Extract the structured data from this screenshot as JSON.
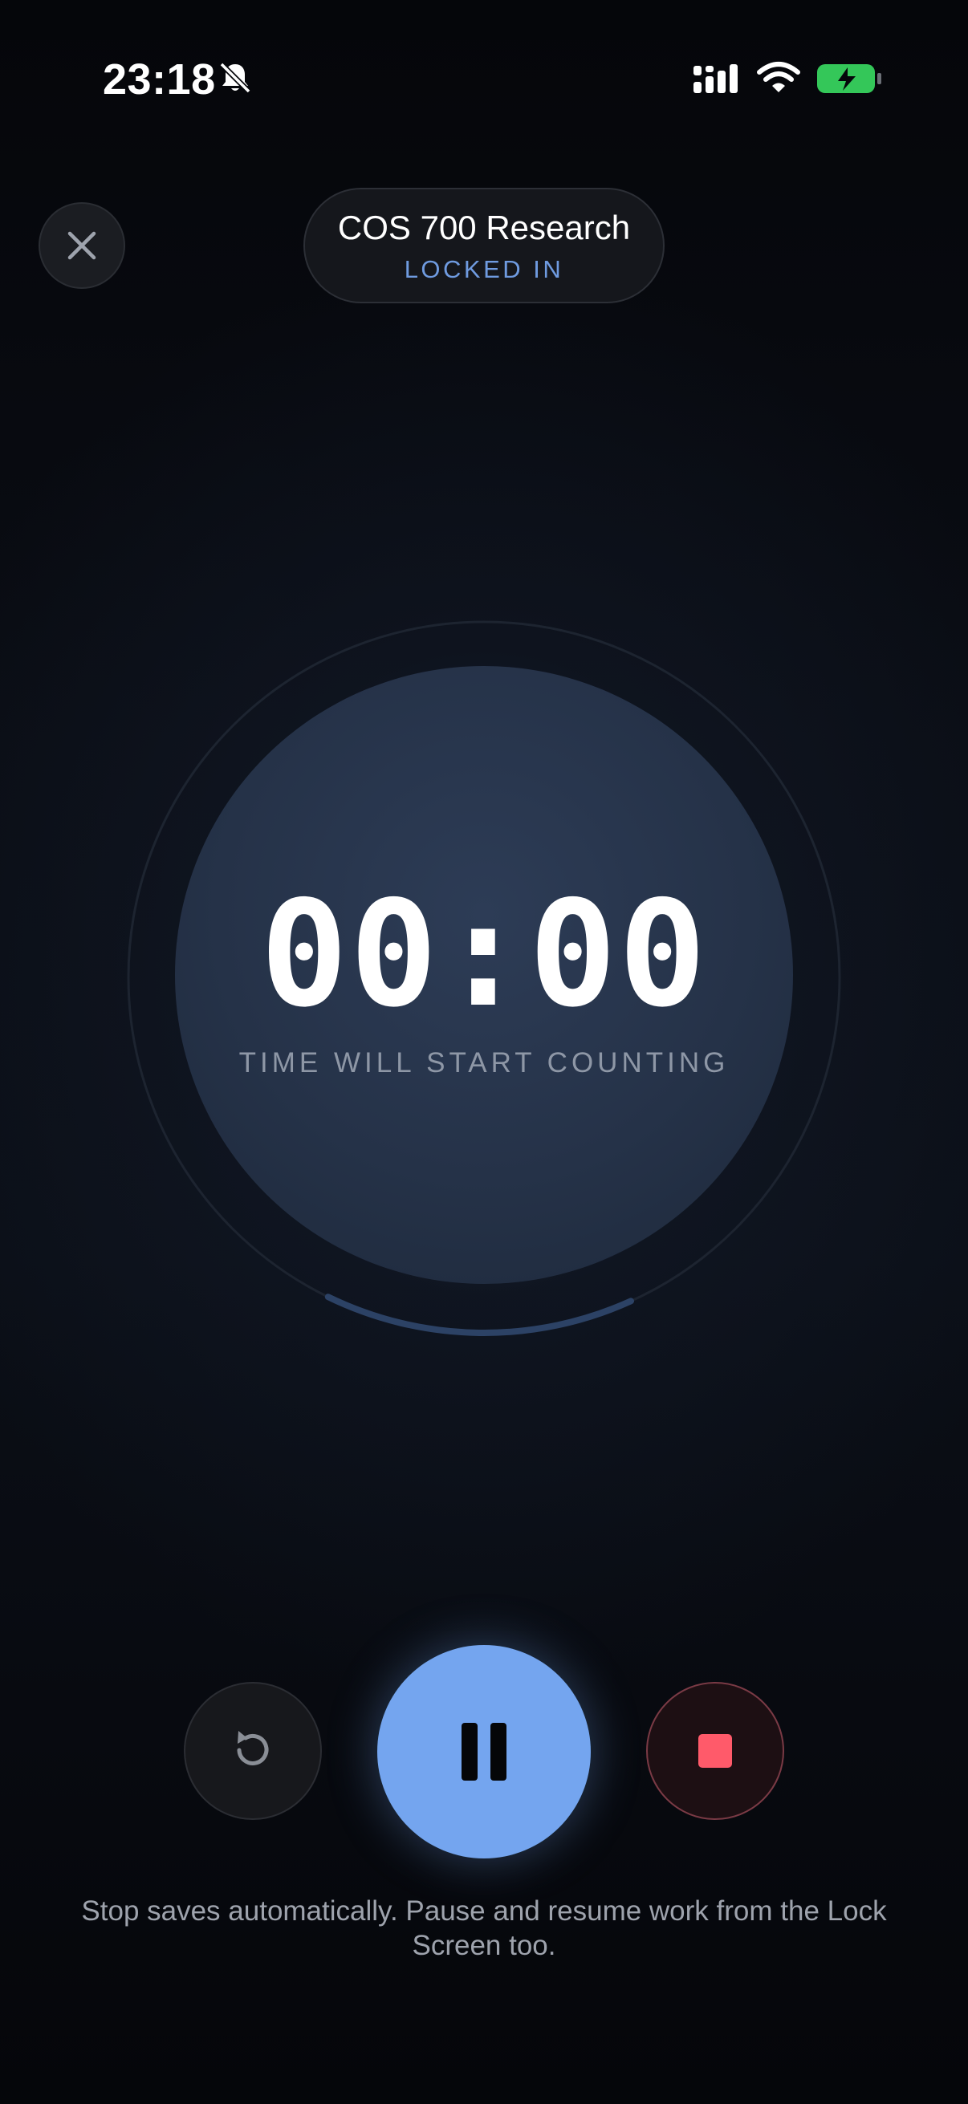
{
  "status_bar": {
    "time": "23:18",
    "icons": [
      "bell-slash-icon",
      "cellular-signal-icon",
      "wifi-icon",
      "battery-charging-icon"
    ],
    "battery_color": "#34c759"
  },
  "header": {
    "close_icon": "close-icon",
    "title": "COS 700 Research",
    "mode_label": "LOCKED IN"
  },
  "timer": {
    "value": "00:00",
    "caption": "TIME WILL START COUNTING",
    "progress_fraction": 0.14
  },
  "controls": {
    "reset_icon": "reset-icon",
    "pause_icon": "pause-icon",
    "stop_icon": "stop-icon",
    "accent_color": "#74a5ef",
    "stop_color": "#ff5a6a"
  },
  "footer": {
    "note": "Stop saves automatically. Pause and resume work from the Lock Screen too."
  }
}
